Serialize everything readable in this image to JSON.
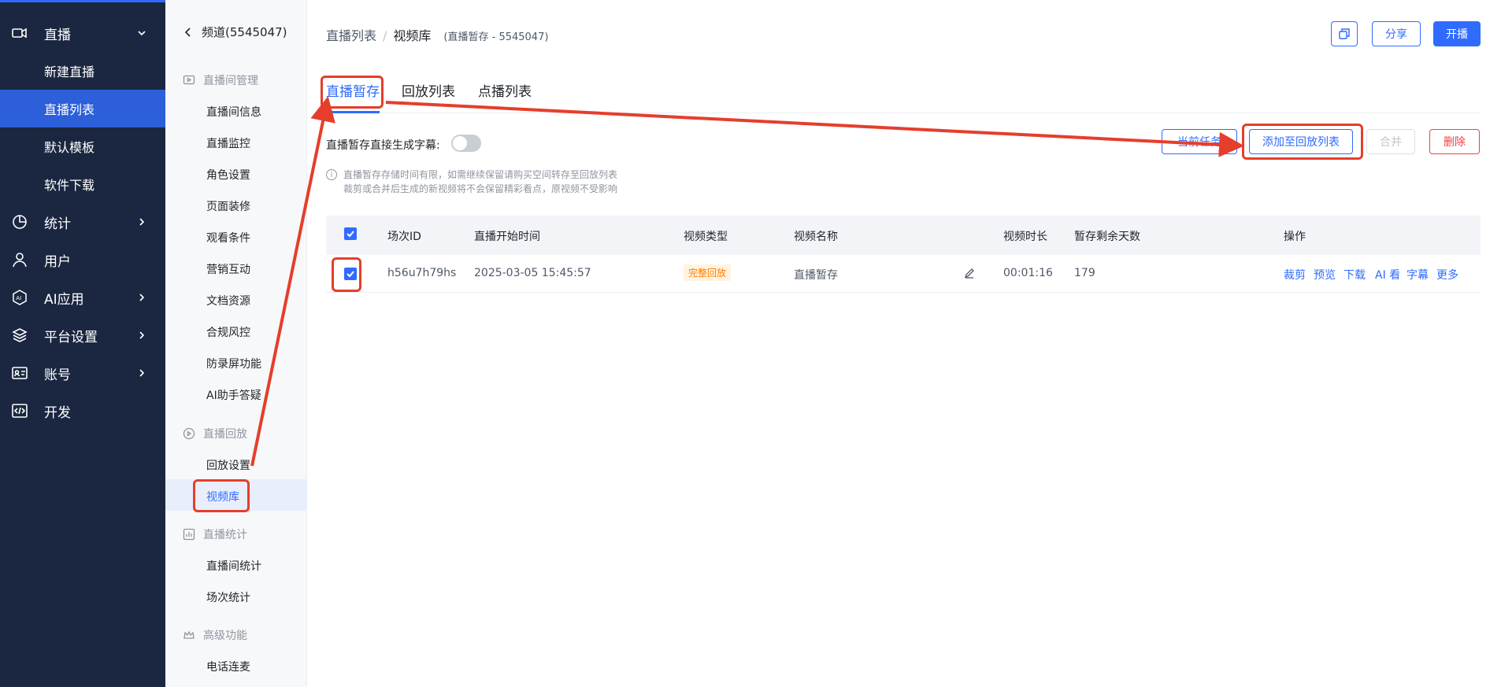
{
  "nav": {
    "items": [
      {
        "label": "直播",
        "icon": "video-camera-icon",
        "arrow": "down"
      },
      {
        "label": "新建直播"
      },
      {
        "label": "直播列表",
        "active": true
      },
      {
        "label": "默认模板"
      },
      {
        "label": "软件下载"
      },
      {
        "label": "统计",
        "icon": "pie-chart-icon",
        "arrow": "right"
      },
      {
        "label": "用户",
        "icon": "user-icon"
      },
      {
        "label": "AI应用",
        "icon": "ai-hexagon-icon",
        "arrow": "right"
      },
      {
        "label": "平台设置",
        "icon": "layers-icon",
        "arrow": "right"
      },
      {
        "label": "账号",
        "icon": "id-card-icon",
        "arrow": "right"
      },
      {
        "label": "开发",
        "icon": "code-icon"
      }
    ]
  },
  "side": {
    "back_label": "频道(5545047)",
    "groups": [
      {
        "label": "直播间管理",
        "icon": "live-room-icon",
        "items": [
          "直播间信息",
          "直播监控",
          "角色设置",
          "页面装修",
          "观看条件",
          "营销互动",
          "文档资源",
          "合规风控",
          "防录屏功能",
          "AI助手答疑"
        ]
      },
      {
        "label": "直播回放",
        "icon": "playback-icon",
        "items": [
          "回放设置",
          "视频库"
        ]
      },
      {
        "label": "直播统计",
        "icon": "bar-chart-icon",
        "items": [
          "直播间统计",
          "场次统计"
        ]
      },
      {
        "label": "高级功能",
        "icon": "crown-icon",
        "items": [
          "电话连麦"
        ]
      }
    ]
  },
  "header": {
    "crumb_parent": "直播列表",
    "crumb_sep": "/",
    "crumb_current": "视频库",
    "crumb_meta": "(直播暂存 - 5545047)",
    "share_label": "分享",
    "live_label": "开播"
  },
  "tabs": [
    "直播暂存",
    "回放列表",
    "点播列表"
  ],
  "toolbar": {
    "toggle_label": "直播暂存直接生成字幕:",
    "notice_line1": "直播暂存存储时间有限，如需继续保留请购买空间转存至回放列表",
    "notice_line2": "裁剪或合并后生成的新视频将不会保留精彩看点，原视频不受影响",
    "task_label": "当前任务",
    "add_label": "添加至回放列表",
    "merge_label": "合并",
    "delete_label": "删除"
  },
  "table": {
    "headers": [
      "场次ID",
      "直播开始时间",
      "视频类型",
      "视频名称",
      "视频时长",
      "暂存剩余天数",
      "操作"
    ],
    "rows": [
      {
        "id": "h56u7h79hs",
        "start": "2025-03-05 15:45:57",
        "type": "完整回放",
        "name": "直播暂存",
        "duration": "00:01:16",
        "days": "179"
      }
    ],
    "ops": [
      "裁剪",
      "预览",
      "下载",
      "AI 看",
      "字幕",
      "更多"
    ]
  },
  "colors": {
    "accent": "#2f6bff",
    "nav_bg": "#1b2740",
    "annotation": "#e53e2c"
  }
}
